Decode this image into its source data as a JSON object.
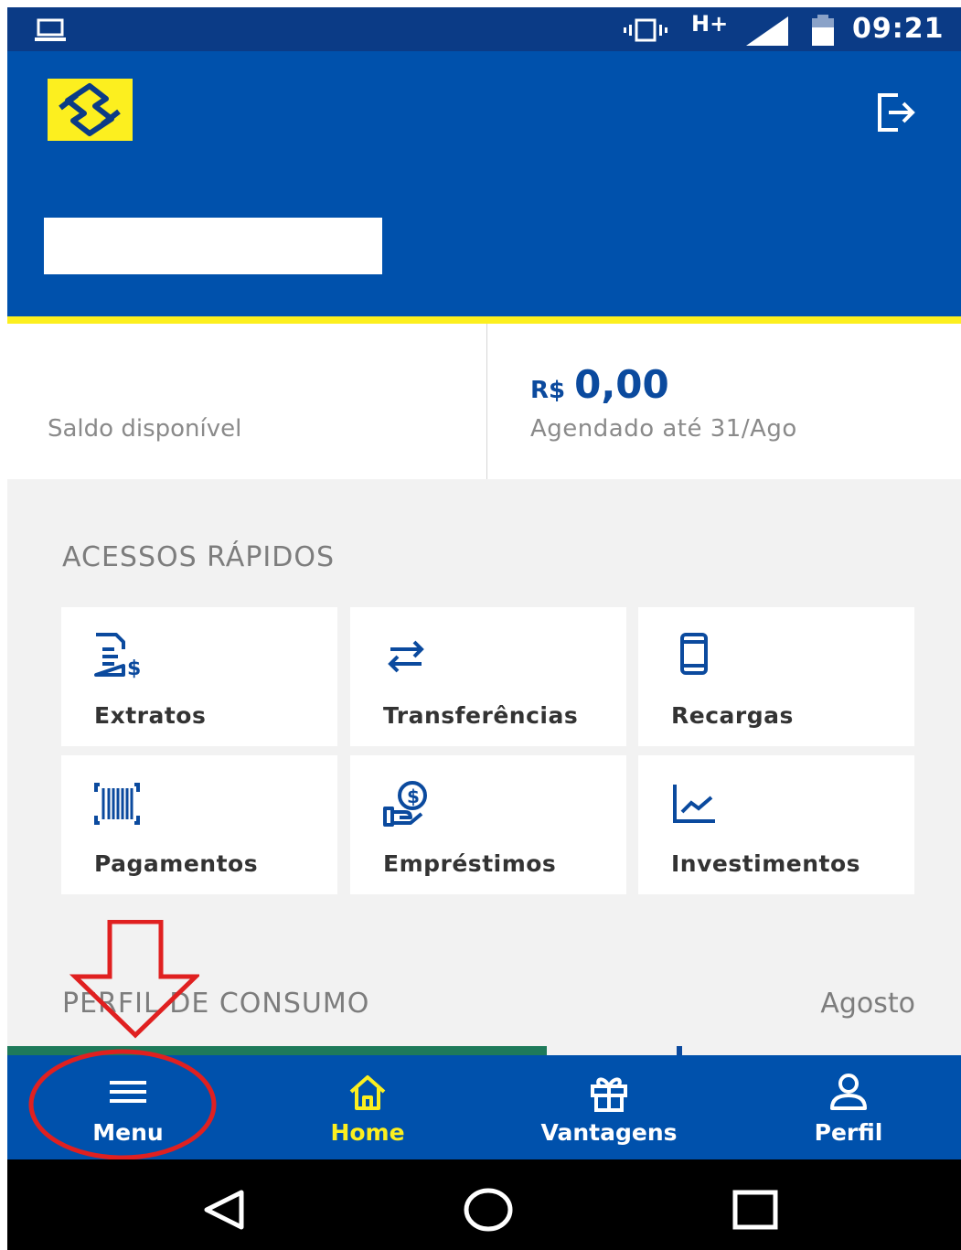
{
  "status_bar": {
    "network": "H+",
    "time": "09:21",
    "icons": [
      "laptop-icon",
      "vibrate-icon",
      "signal-icon",
      "battery-icon"
    ]
  },
  "header": {
    "logo": "banco-do-brasil-logo",
    "logout_icon": "logout-icon"
  },
  "balance": {
    "label": "Saldo disponível",
    "currency": "R$",
    "amount": "0,00",
    "scheduled": "Agendado até 31/Ago"
  },
  "quick_access": {
    "title": "ACESSOS RÁPIDOS",
    "items": [
      {
        "label": "Extratos",
        "icon": "statement-icon"
      },
      {
        "label": "Transferências",
        "icon": "transfer-icon"
      },
      {
        "label": "Recargas",
        "icon": "phone-icon"
      },
      {
        "label": "Pagamentos",
        "icon": "barcode-icon"
      },
      {
        "label": "Empréstimos",
        "icon": "loan-icon"
      },
      {
        "label": "Investimentos",
        "icon": "chart-icon"
      }
    ]
  },
  "consumption": {
    "title": "PERFIL DE CONSUMO",
    "month": "Agosto"
  },
  "bottom_nav": {
    "items": [
      {
        "label": "Menu",
        "icon": "hamburger-icon"
      },
      {
        "label": "Home",
        "icon": "home-icon",
        "active": true
      },
      {
        "label": "Vantagens",
        "icon": "gift-icon"
      },
      {
        "label": "Perfil",
        "icon": "user-icon"
      }
    ]
  },
  "colors": {
    "primary": "#0051ac",
    "accent": "#fcef1f",
    "annotation": "#e02020"
  }
}
